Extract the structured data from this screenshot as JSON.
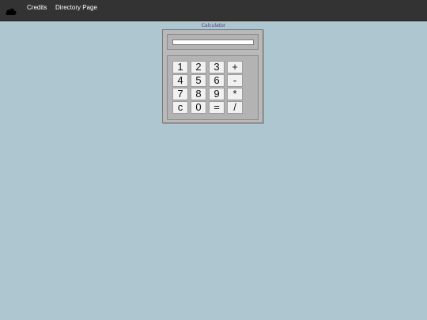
{
  "nav": {
    "logo_icon": "cloud-icon",
    "links": [
      "Credits",
      "Directory Page"
    ]
  },
  "calculator": {
    "title": "Calculator",
    "display_value": "",
    "keys": [
      [
        "1",
        "2",
        "3",
        "+"
      ],
      [
        "4",
        "5",
        "6",
        "-"
      ],
      [
        "7",
        "8",
        "9",
        "*"
      ],
      [
        "c",
        "0",
        "=",
        "/"
      ]
    ]
  },
  "colors": {
    "page_background": "#aec6cf",
    "navbar": "#333333",
    "calculator_body": "#b9b9b9",
    "key_face": "#f1f1f1",
    "title_text": "#4a3d7a"
  }
}
